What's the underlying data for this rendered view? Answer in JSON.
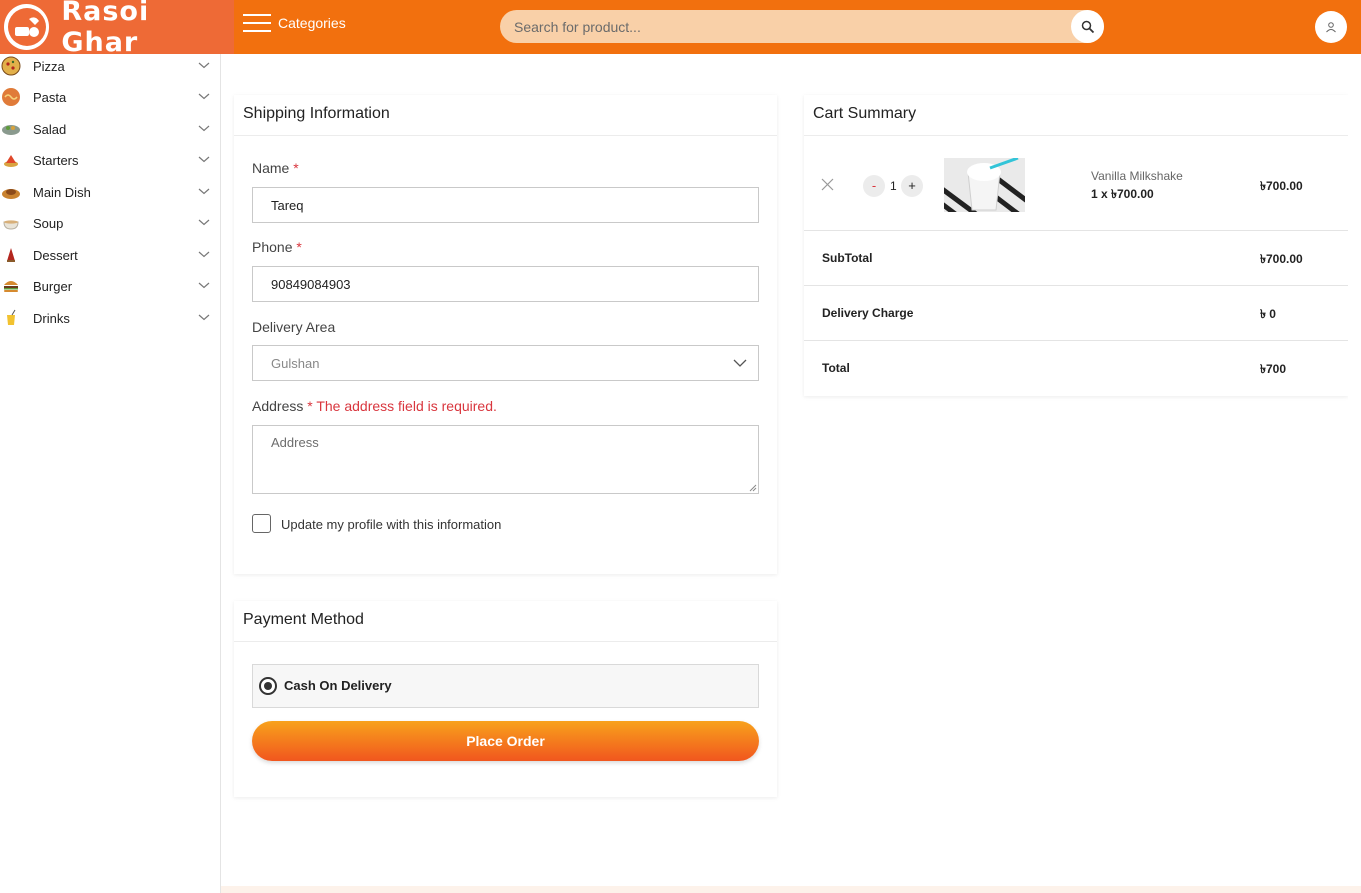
{
  "header": {
    "brand_name": "Rasoi Ghar",
    "categories_label": "Categories",
    "search_placeholder": "Search for product...",
    "accent_color": "#f2700e"
  },
  "sidebar": {
    "items": [
      {
        "label": "Pizza",
        "icon": "pizza-icon"
      },
      {
        "label": "Pasta",
        "icon": "pasta-icon"
      },
      {
        "label": "Salad",
        "icon": "salad-icon"
      },
      {
        "label": "Starters",
        "icon": "starters-icon"
      },
      {
        "label": "Main Dish",
        "icon": "main-dish-icon"
      },
      {
        "label": "Soup",
        "icon": "soup-icon"
      },
      {
        "label": "Dessert",
        "icon": "dessert-icon"
      },
      {
        "label": "Burger",
        "icon": "burger-icon"
      },
      {
        "label": "Drinks",
        "icon": "drinks-icon"
      }
    ]
  },
  "shipping": {
    "title": "Shipping Information",
    "name_label": "Name",
    "name_value": "Tareq",
    "phone_label": "Phone",
    "phone_value": "90849084903",
    "area_label": "Delivery Area",
    "area_value": "Gulshan",
    "address_label": "Address",
    "required_mark": "*",
    "address_error": "* The address field is required.",
    "address_placeholder": "Address",
    "update_profile_label": "Update my profile with this information"
  },
  "payment": {
    "title": "Payment Method",
    "option_label": "Cash On Delivery",
    "place_order_label": "Place Order"
  },
  "cart": {
    "title": "Cart Summary",
    "items": [
      {
        "name": "Vanilla Milkshake",
        "qty_line": "1 x ৳700.00",
        "quantity": "1",
        "total": "৳700.00"
      }
    ],
    "minus_label": "-",
    "plus_label": "+",
    "subtotal_label": "SubTotal",
    "subtotal_value": "৳700.00",
    "delivery_label": "Delivery Charge",
    "delivery_value": "৳ 0",
    "total_label": "Total",
    "total_value": "৳700"
  }
}
